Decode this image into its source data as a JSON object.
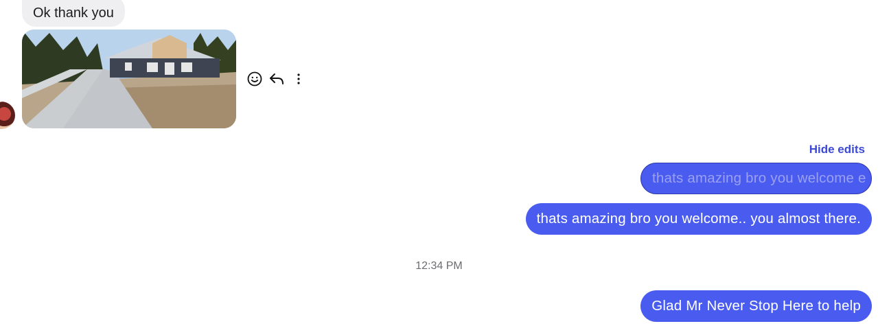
{
  "messages": {
    "incoming_text": "Ok thank you",
    "edited_previous": "thats amazing bro you welcome e",
    "edited_current": "thats amazing bro you welcome.. you almost there.",
    "last": "Glad Mr Never Stop Here to help"
  },
  "hide_edits_label": "Hide edits",
  "timestamp": "12:34 PM",
  "icons": {
    "react": "smiley-icon",
    "reply": "reply-arrow-icon",
    "more": "more-vertical-icon"
  },
  "colors": {
    "outgoing_bubble": "#4a5cf0",
    "incoming_bubble": "#efeff1",
    "link": "#3b4ad6"
  }
}
